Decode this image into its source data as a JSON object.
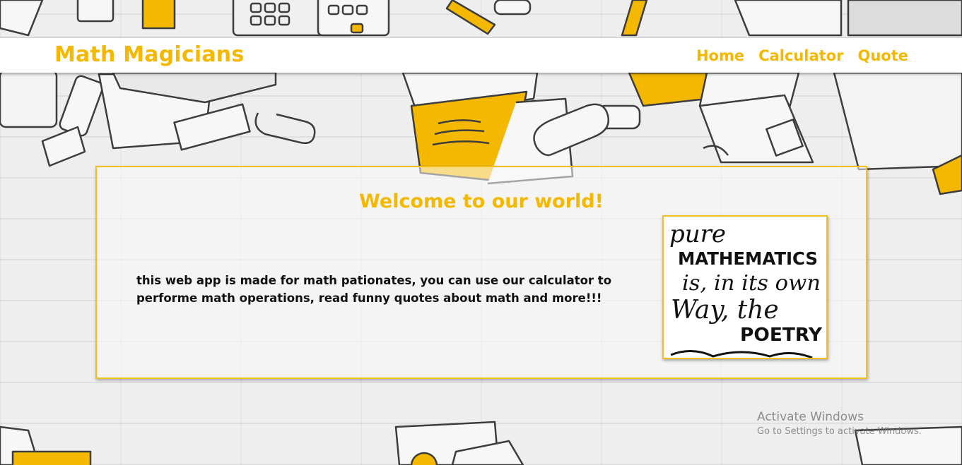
{
  "navbar": {
    "brand": "Math Magicians",
    "links": [
      {
        "label": "Home"
      },
      {
        "label": "Calculator"
      },
      {
        "label": "Quote"
      }
    ]
  },
  "welcome": {
    "title": "Welcome to our world!",
    "text": "this web app is made for math pationates, you can use our calculator to performe math operations, read funny quotes about math and more!!!",
    "quote_image": {
      "line1": "pure",
      "line2": "MATHEMATICS",
      "line3": "is, in its own",
      "line4": "Way, the",
      "line5": "POETRY"
    }
  },
  "watermark": {
    "title": "Activate Windows",
    "subtitle": "Go to Settings to activate Windows."
  },
  "colors": {
    "accent": "#f5b800",
    "text": "#111111",
    "card_border": "#f4c020"
  }
}
